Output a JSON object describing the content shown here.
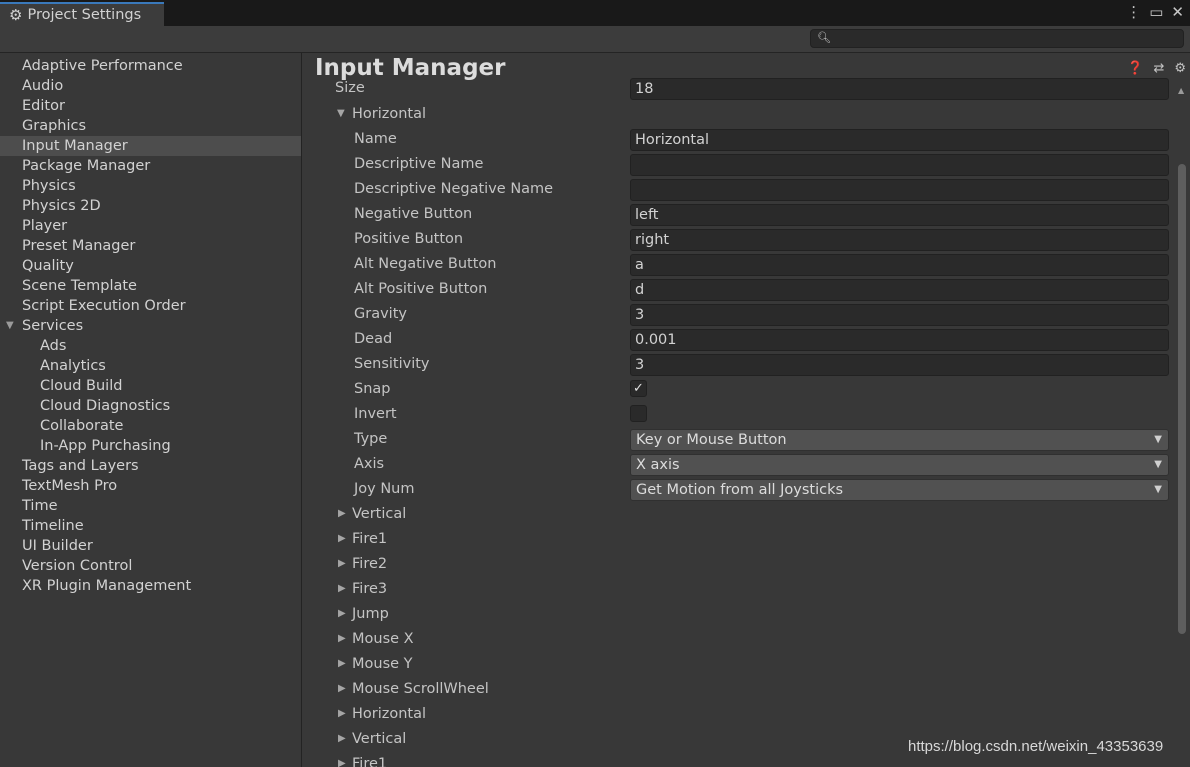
{
  "window": {
    "tab_title": "Project Settings",
    "controls": [
      "⋮",
      "▭",
      "✕"
    ]
  },
  "search": {
    "placeholder": "",
    "icon": "search-icon"
  },
  "sidebar": {
    "items": [
      {
        "label": "Adaptive Performance"
      },
      {
        "label": "Audio"
      },
      {
        "label": "Editor"
      },
      {
        "label": "Graphics"
      },
      {
        "label": "Input Manager",
        "selected": true
      },
      {
        "label": "Package Manager"
      },
      {
        "label": "Physics"
      },
      {
        "label": "Physics 2D"
      },
      {
        "label": "Player"
      },
      {
        "label": "Preset Manager"
      },
      {
        "label": "Quality"
      },
      {
        "label": "Scene Template"
      },
      {
        "label": "Script Execution Order"
      },
      {
        "label": "Services",
        "expanded": true
      },
      {
        "label": "Ads",
        "sub": true
      },
      {
        "label": "Analytics",
        "sub": true
      },
      {
        "label": "Cloud Build",
        "sub": true
      },
      {
        "label": "Cloud Diagnostics",
        "sub": true
      },
      {
        "label": "Collaborate",
        "sub": true
      },
      {
        "label": "In-App Purchasing",
        "sub": true
      },
      {
        "label": "Tags and Layers"
      },
      {
        "label": "TextMesh Pro"
      },
      {
        "label": "Time"
      },
      {
        "label": "Timeline"
      },
      {
        "label": "UI Builder"
      },
      {
        "label": "Version Control"
      },
      {
        "label": "XR Plugin Management"
      }
    ]
  },
  "main": {
    "title": "Input Manager",
    "header_icons": [
      "help-icon",
      "preset-icon",
      "settings-icon"
    ],
    "size": {
      "label": "Size",
      "value": "18"
    },
    "axis": {
      "label": "Horizontal",
      "fields": [
        {
          "label": "Name",
          "type": "text",
          "value": "Horizontal"
        },
        {
          "label": "Descriptive Name",
          "type": "text",
          "value": ""
        },
        {
          "label": "Descriptive Negative Name",
          "type": "text",
          "value": ""
        },
        {
          "label": "Negative Button",
          "type": "text",
          "value": "left"
        },
        {
          "label": "Positive Button",
          "type": "text",
          "value": "right"
        },
        {
          "label": "Alt Negative Button",
          "type": "text",
          "value": "a"
        },
        {
          "label": "Alt Positive Button",
          "type": "text",
          "value": "d"
        },
        {
          "label": "Gravity",
          "type": "text",
          "value": "3"
        },
        {
          "label": "Dead",
          "type": "text",
          "value": "0.001"
        },
        {
          "label": "Sensitivity",
          "type": "text",
          "value": "3"
        },
        {
          "label": "Snap",
          "type": "check",
          "checked": true
        },
        {
          "label": "Invert",
          "type": "check",
          "checked": false
        },
        {
          "label": "Type",
          "type": "dropdown",
          "value": "Key or Mouse Button"
        },
        {
          "label": "Axis",
          "type": "dropdown",
          "value": "X axis"
        },
        {
          "label": "Joy Num",
          "type": "dropdown",
          "value": "Get Motion from all Joysticks"
        }
      ]
    },
    "collapsed_axes": [
      "Vertical",
      "Fire1",
      "Fire2",
      "Fire3",
      "Jump",
      "Mouse X",
      "Mouse Y",
      "Mouse ScrollWheel",
      "Horizontal",
      "Vertical",
      "Fire1"
    ]
  },
  "watermark": "https://blog.csdn.net/weixin_43353639"
}
